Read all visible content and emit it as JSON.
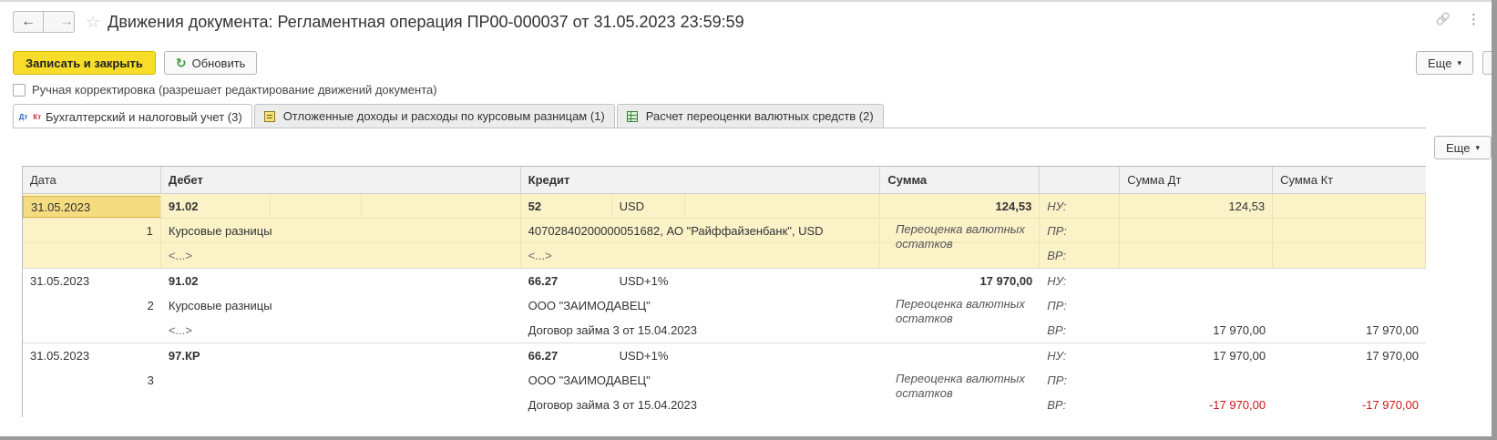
{
  "window": {
    "title": "Движения документа: Регламентная операция ПР00-000037 от 31.05.2023 23:59:59",
    "back_icon": "←",
    "forward_icon": "→",
    "star_icon": "☆",
    "link_icon": "🔗",
    "menu_icon": "⋮"
  },
  "toolbar": {
    "save_close_label": "Записать и закрыть",
    "refresh_label": "Обновить",
    "refresh_icon": "↻",
    "more_label": "Еще",
    "caret": "▾"
  },
  "manual_edit_label": "Ручная корректировка (разрешает редактирование движений документа)",
  "tabs": [
    {
      "label": "Бухгалтерский и налоговый учет (3)",
      "active": true
    },
    {
      "label": "Отложенные доходы и расходы по курсовым разницам (1)",
      "active": false
    },
    {
      "label": "Расчет переоценки валютных средств (2)",
      "active": false
    }
  ],
  "tab_icon_text": {
    "d": "Дт",
    "k": "Кт"
  },
  "table_more_label": "Еще",
  "columns": {
    "date": "Дата",
    "debit": "Дебет",
    "credit": "Кредит",
    "sum": "Сумма",
    "label": "",
    "sum_dt": "Сумма Дт",
    "sum_kt": "Сумма Кт"
  },
  "rows": [
    {
      "date": "31.05.2023",
      "num": "1",
      "debit_account": "91.02",
      "debit_sub1": "Курсовые разницы",
      "debit_sub2": "<...>",
      "credit_account": "52",
      "credit_currency": "USD",
      "credit_sub1": "40702840200000051682, АО \"Райффайзенбанк\", USD",
      "credit_sub2": "<...>",
      "sum": "124,53",
      "comment": "Переоценка валютных остатков",
      "lbl_nu": "НУ:",
      "lbl_pr": "ПР:",
      "lbl_vr": "ВР:",
      "nu_dt": "124,53",
      "nu_kt": "",
      "pr_dt": "",
      "pr_kt": "",
      "vr_dt": "",
      "vr_kt": ""
    },
    {
      "date": "31.05.2023",
      "num": "2",
      "debit_account": "91.02",
      "debit_sub1": "Курсовые разницы",
      "debit_sub2": "<...>",
      "credit_account": "66.27",
      "credit_currency": "USD+1%",
      "credit_sub1": "ООО \"ЗАИМОДАВЕЦ\"",
      "credit_sub2": "Договор займа 3 от 15.04.2023",
      "sum": "17 970,00",
      "comment": "Переоценка валютных остатков",
      "lbl_nu": "НУ:",
      "lbl_pr": "ПР:",
      "lbl_vr": "ВР:",
      "nu_dt": "",
      "nu_kt": "",
      "pr_dt": "",
      "pr_kt": "",
      "vr_dt": "17 970,00",
      "vr_kt": "17 970,00"
    },
    {
      "date": "31.05.2023",
      "num": "3",
      "debit_account": "97.КР",
      "debit_sub1": "",
      "debit_sub2": "",
      "credit_account": "66.27",
      "credit_currency": "USD+1%",
      "credit_sub1": "ООО \"ЗАИМОДАВЕЦ\"",
      "credit_sub2": "Договор займа 3 от 15.04.2023",
      "sum": "",
      "comment": "Переоценка валютных остатков",
      "lbl_nu": "НУ:",
      "lbl_pr": "ПР:",
      "lbl_vr": "ВР:",
      "nu_dt": "17 970,00",
      "nu_kt": "17 970,00",
      "pr_dt": "",
      "pr_kt": "",
      "vr_dt": "-17 970,00",
      "vr_kt": "-17 970,00"
    }
  ],
  "colors": {
    "primary_button": "#f7dc2a",
    "selected_row": "#fbf2c8",
    "negative": "#d01616"
  }
}
